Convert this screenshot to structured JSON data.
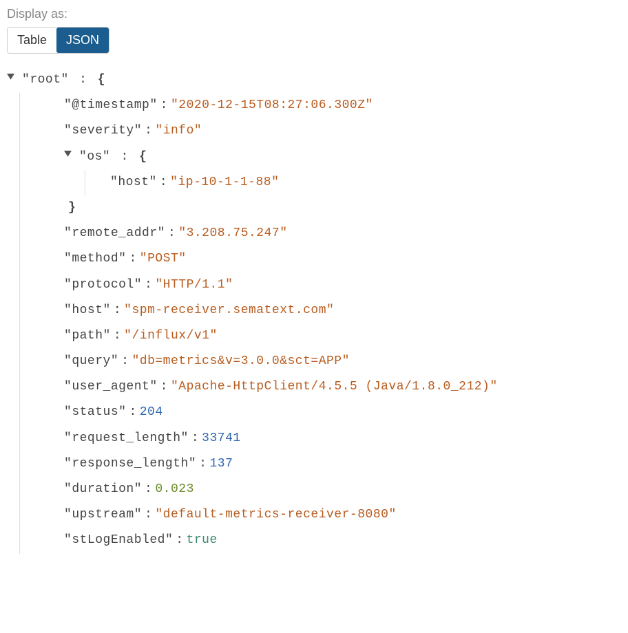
{
  "header": {
    "display_as_label": "Display as:",
    "toggle_table": "Table",
    "toggle_json": "JSON"
  },
  "json": {
    "root_key": "root",
    "colon": ":",
    "open_brace": "{",
    "close_brace": "}",
    "fields": {
      "timestamp_key": "@timestamp",
      "timestamp_val": "2020-12-15T08:27:06.300Z",
      "severity_key": "severity",
      "severity_val": "info",
      "os_key": "os",
      "os_host_key": "host",
      "os_host_val": "ip-10-1-1-88",
      "remote_addr_key": "remote_addr",
      "remote_addr_val": "3.208.75.247",
      "method_key": "method",
      "method_val": "POST",
      "protocol_key": "protocol",
      "protocol_val": "HTTP/1.1",
      "host_key": "host",
      "host_val": "spm-receiver.sematext.com",
      "path_key": "path",
      "path_val": "/influx/v1",
      "query_key": "query",
      "query_val": "db=metrics&v=3.0.0&sct=APP",
      "user_agent_key": "user_agent",
      "user_agent_val": "Apache-HttpClient/4.5.5 (Java/1.8.0_212)",
      "status_key": "status",
      "status_val": "204",
      "request_length_key": "request_length",
      "request_length_val": "33741",
      "response_length_key": "response_length",
      "response_length_val": "137",
      "duration_key": "duration",
      "duration_val": "0.023",
      "upstream_key": "upstream",
      "upstream_val": "default-metrics-receiver-8080",
      "stlog_key": "stLogEnabled",
      "stlog_val": "true"
    }
  }
}
